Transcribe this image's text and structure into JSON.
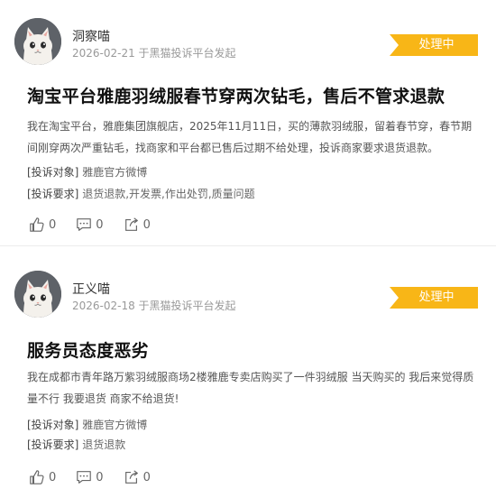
{
  "complaints": [
    {
      "user": "洞察喵",
      "meta": "2026-02-21 于黑猫投诉平台发起",
      "status": "处理中",
      "title": "淘宝平台雅鹿羽绒服春节穿两次钻毛，售后不管求退款",
      "desc": "我在淘宝平台，雅鹿集团旗舰店，2025年11月11日，买的薄款羽绒服，留着春节穿，春节期间刚穿两次严重钻毛，找商家和平台都已售后过期不给处理，投诉商家要求退货退款。",
      "target_label": "[投诉对象]",
      "target": "雅鹿官方微博",
      "demand_label": "[投诉要求]",
      "demand": "退货退款,开发票,作出处罚,质量问题",
      "likes": "0",
      "comments": "0",
      "shares": "0"
    },
    {
      "user": "正义喵",
      "meta": "2026-02-18 于黑猫投诉平台发起",
      "status": "处理中",
      "title": "服务员态度恶劣",
      "desc": "我在成都市青年路万紫羽绒服商场2楼雅鹿专卖店购买了一件羽绒服 当天购买的 我后来觉得质量不行 我要退货 商家不给退货!",
      "target_label": "[投诉对象]",
      "target": "雅鹿官方微博",
      "demand_label": "[投诉要求]",
      "demand": "退货退款",
      "likes": "0",
      "comments": "0",
      "shares": "0"
    }
  ],
  "colors": {
    "status_bg": "#f8b617",
    "avatar_bg": "#5e6268"
  },
  "icons": {
    "like": "thumb-up-icon",
    "comment": "comment-icon",
    "share": "share-icon"
  }
}
